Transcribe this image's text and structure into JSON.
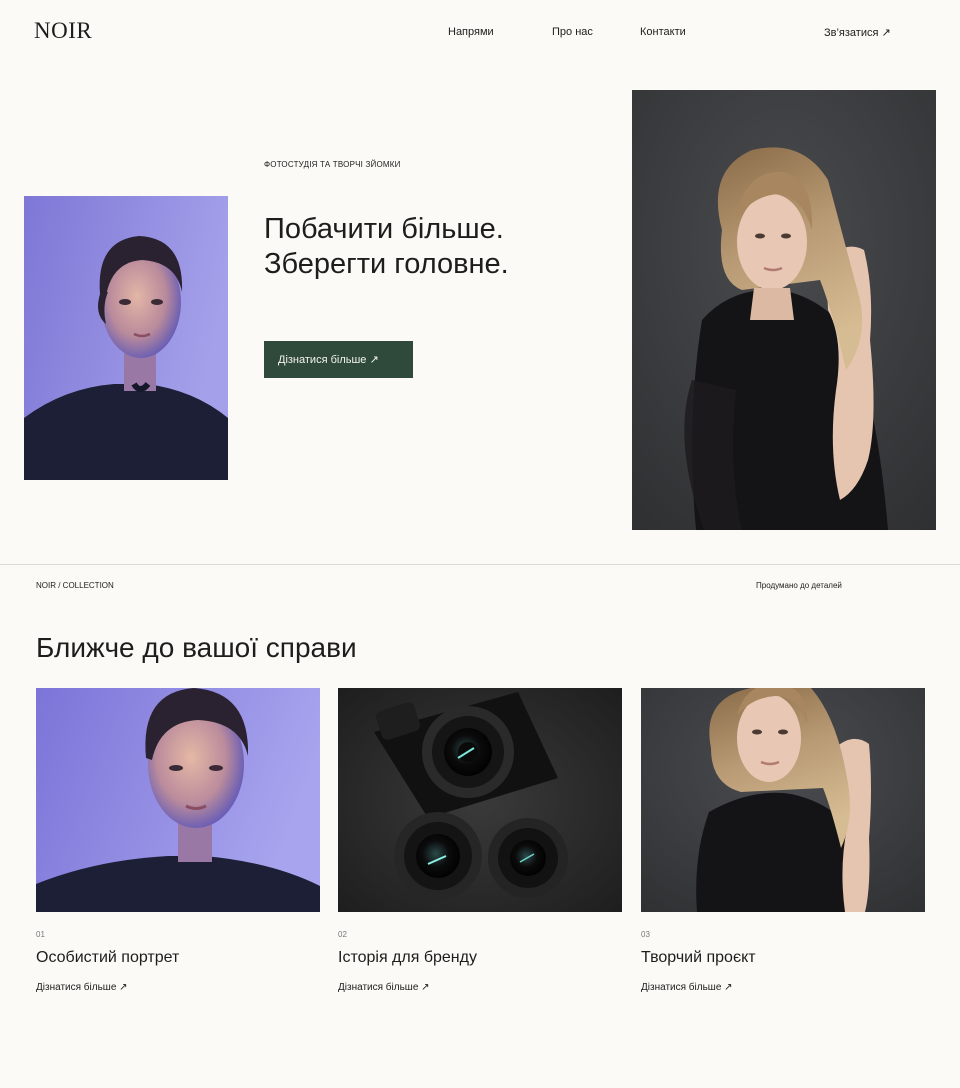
{
  "header": {
    "logo": "NOIR",
    "nav": [
      "Напрями",
      "Про нас",
      "Контакти"
    ],
    "contact_label": "Зв’язатися ↗"
  },
  "hero": {
    "eyebrow": "ФОТОСТУДІЯ ТА ТВОРЧІ ЗЙОМКИ",
    "title_line1": "Побачити більше.",
    "title_line2": "Зберегти головне.",
    "cta_label": "Дізнатися більше ↗"
  },
  "collection": {
    "meta_left": "NOIR / COLLECTION",
    "meta_right": "Продумано до деталей",
    "title": "Ближче до вашої справи",
    "cards": [
      {
        "num": "01",
        "title": "Особистий портрет",
        "link": "Дізнатися більше ↗"
      },
      {
        "num": "02",
        "title": "Історія для бренду",
        "link": "Дізнатися більше ↗"
      },
      {
        "num": "03",
        "title": "Творчий проєкт",
        "link": "Дізнатися більше ↗"
      }
    ]
  },
  "colors": {
    "background": "#fbfaf6",
    "text": "#1d1d1b",
    "cta_background": "#2f4a3a",
    "cta_text": "#f4f3ee"
  }
}
